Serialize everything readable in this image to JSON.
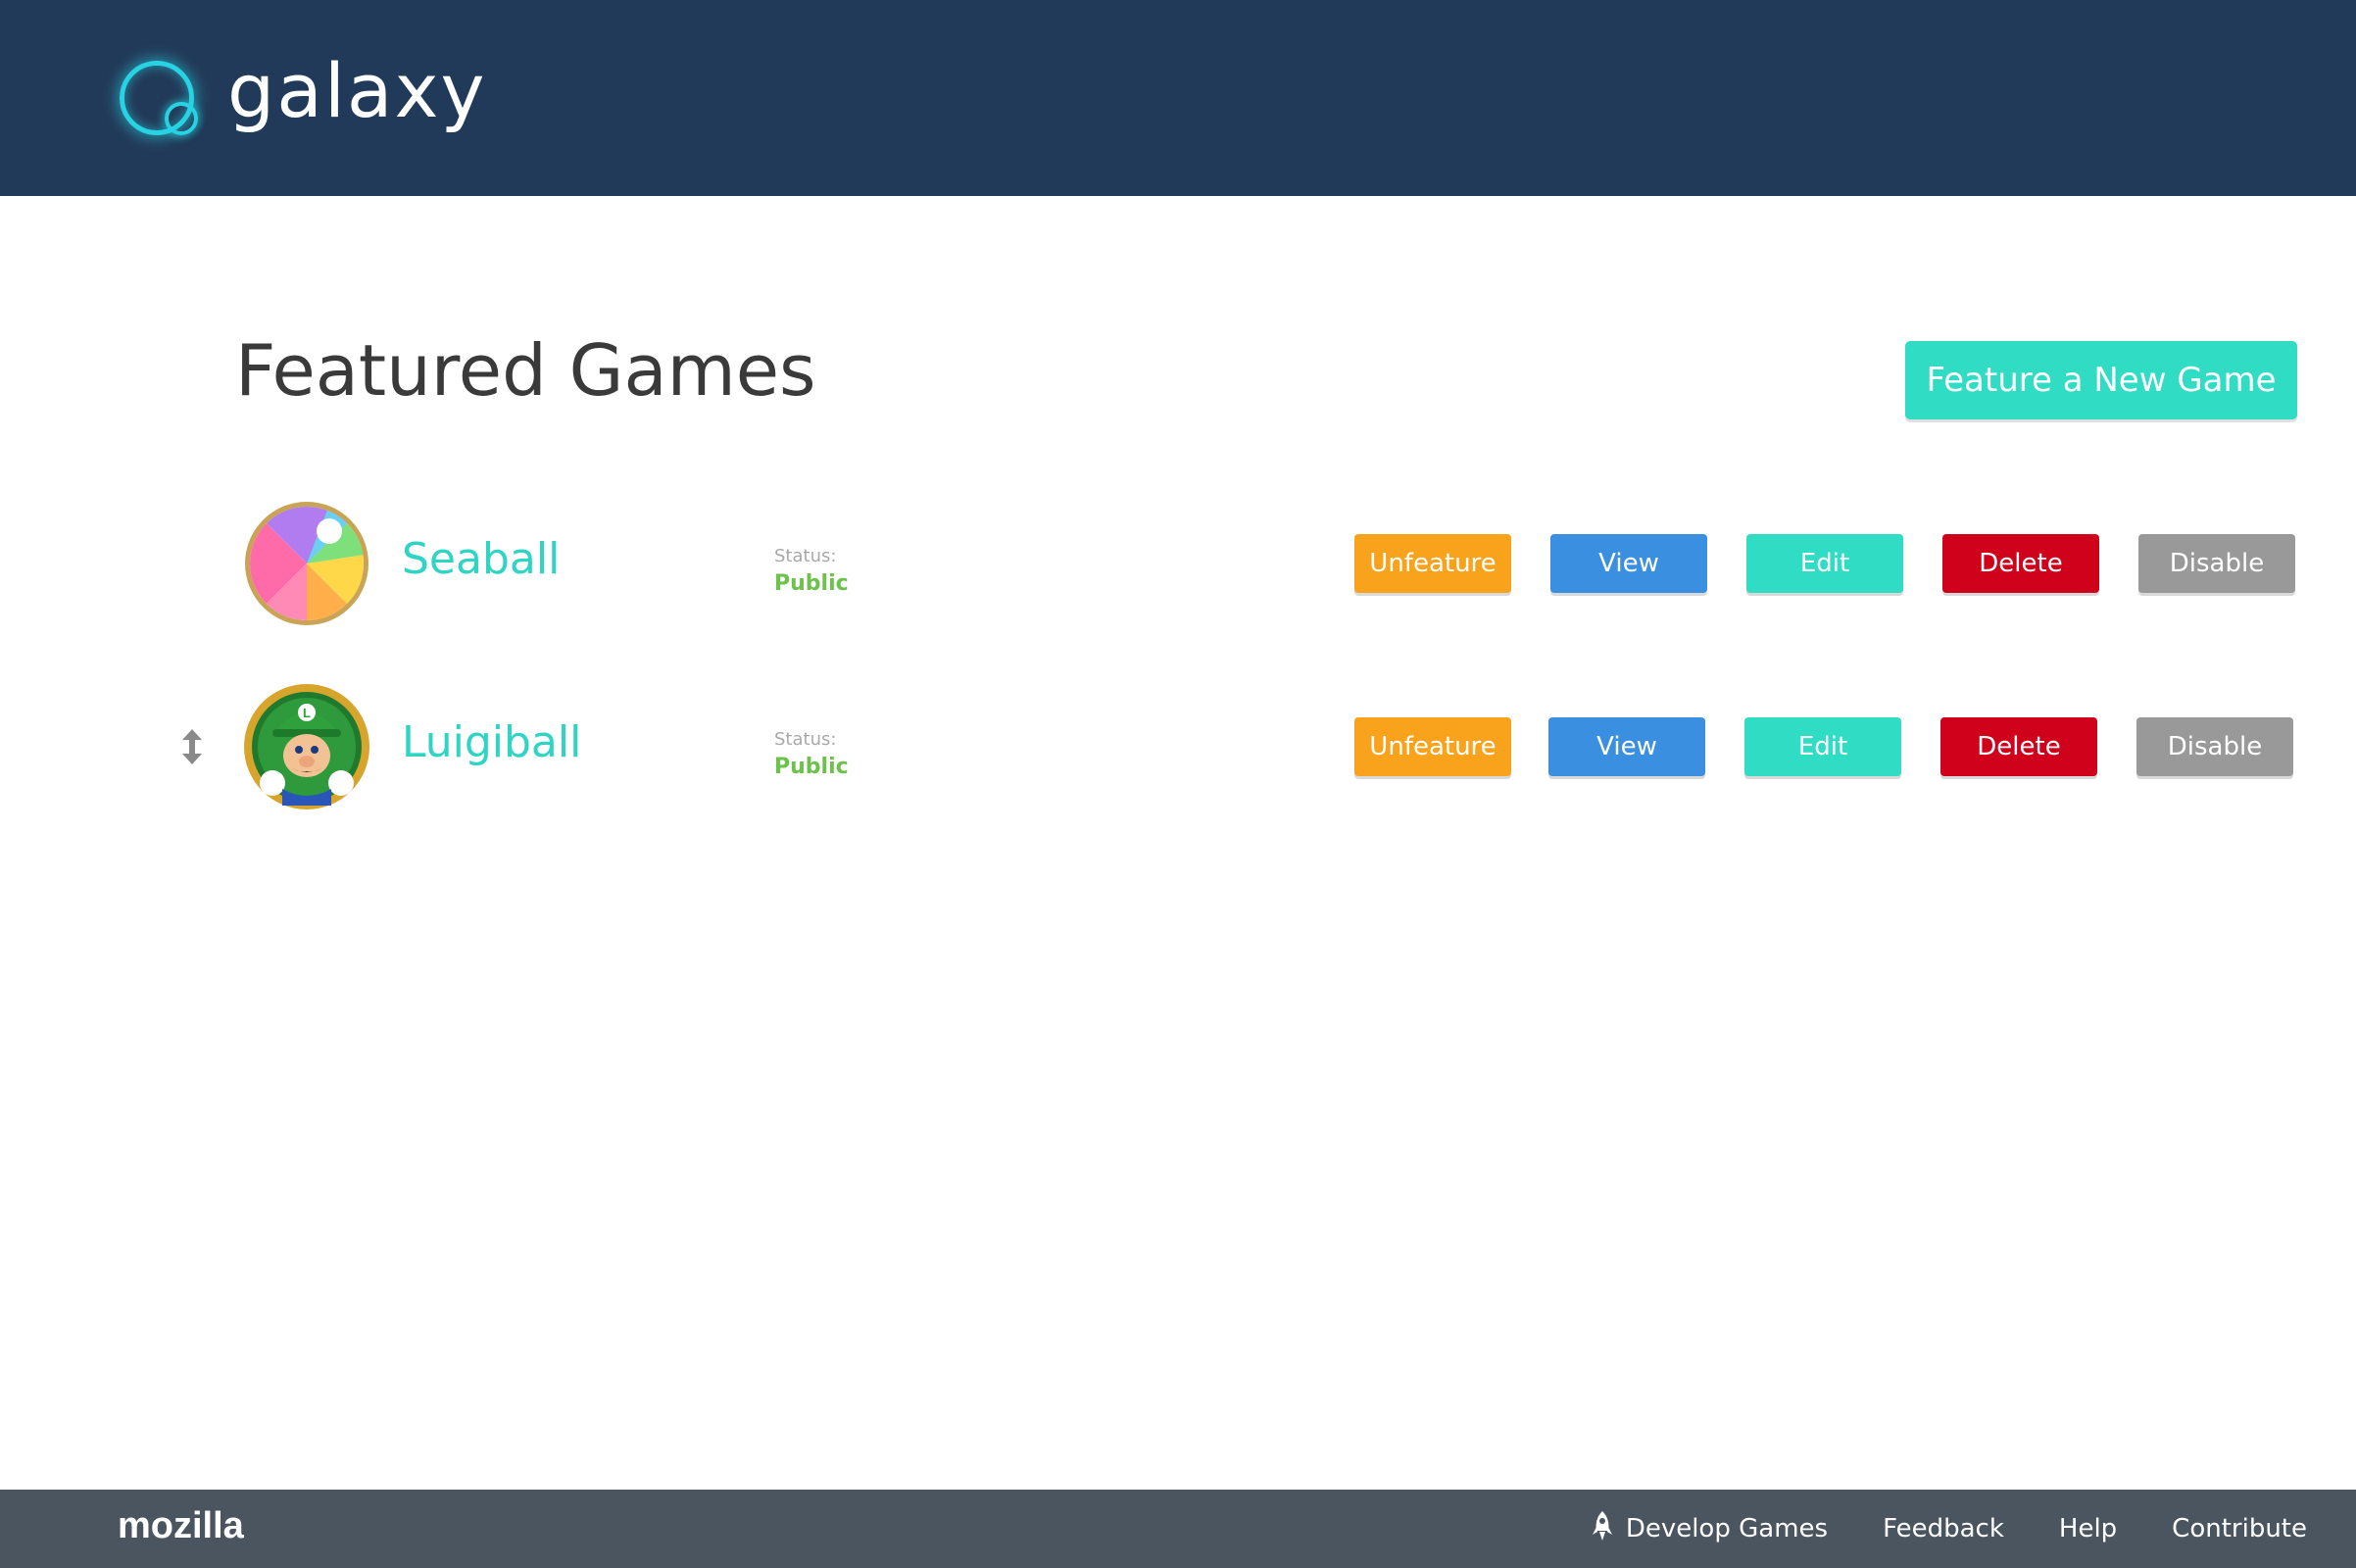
{
  "header": {
    "logo_text": "galaxy"
  },
  "main": {
    "title": "Featured Games",
    "feature_button_label": "Feature a New Game"
  },
  "games": [
    {
      "name": "Seaball",
      "status_label": "Status:",
      "status_value": "Public",
      "avatar_icon": "beach-ball",
      "buttons": {
        "unfeature": "Unfeature",
        "view": "View",
        "edit": "Edit",
        "delete": "Delete",
        "disable": "Disable"
      }
    },
    {
      "name": "Luigiball",
      "status_label": "Status:",
      "status_value": "Public",
      "avatar_icon": "luigi-character",
      "buttons": {
        "unfeature": "Unfeature",
        "view": "View",
        "edit": "Edit",
        "delete": "Delete",
        "disable": "Disable"
      }
    }
  ],
  "footer": {
    "logo": "mozilla",
    "links": [
      "Develop Games",
      "Feedback",
      "Help",
      "Contribute"
    ]
  },
  "colors": {
    "header_bg": "#223a59",
    "accent_teal": "#31dcc4",
    "unfeature": "#f9a21c",
    "view": "#3a8fe0",
    "delete": "#d0021b",
    "disable": "#999999",
    "status_public": "#6cc24a",
    "footer_bg": "#4a555f"
  }
}
